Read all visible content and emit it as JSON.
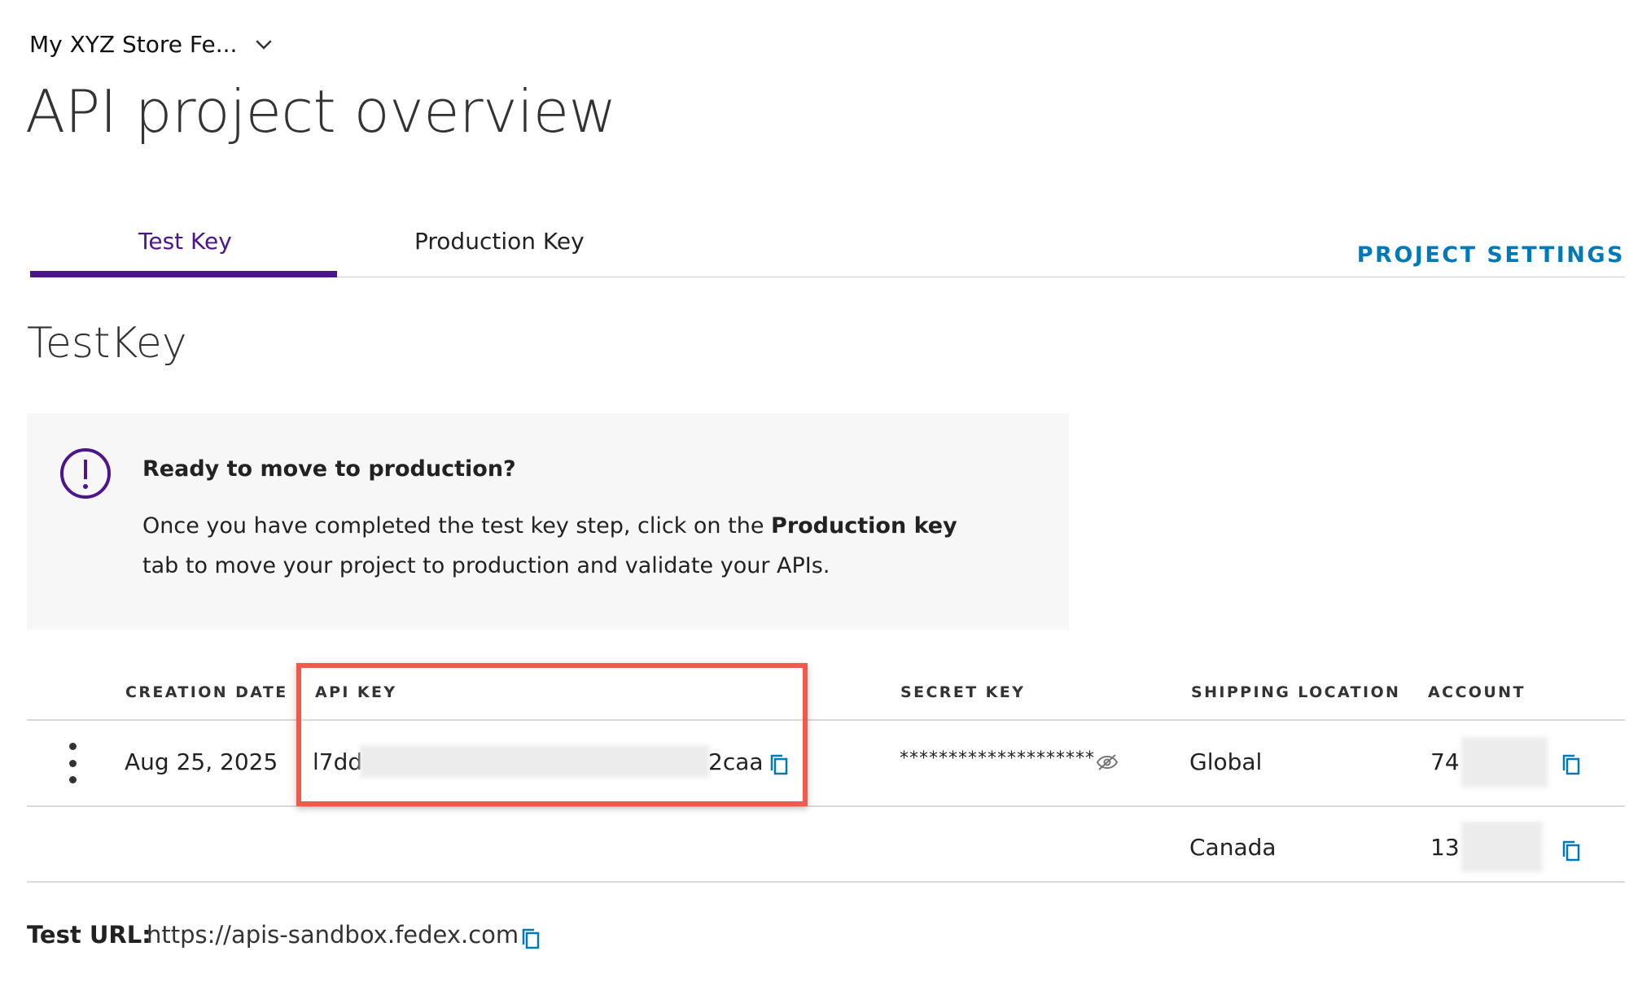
{
  "header": {
    "project_name": "My XYZ Store Fe...",
    "title": "API project overview"
  },
  "tabs": [
    {
      "label": "Test Key",
      "active": true
    },
    {
      "label": "Production Key",
      "active": false
    }
  ],
  "project_settings_label": "PROJECT SETTINGS",
  "section_title": "TestKey",
  "info": {
    "heading": "Ready to move to production?",
    "text_before": "Once you have completed the test key step, click on the ",
    "text_bold": "Production key",
    "text_after": " tab to move your project to production and validate your APIs."
  },
  "table": {
    "headers": {
      "creation_date": "CREATION DATE",
      "api_key": "API KEY",
      "secret_key": "SECRET KEY",
      "shipping_location": "SHIPPING LOCATION",
      "account": "ACCOUNT"
    },
    "rows": [
      {
        "creation_date": "Aug 25, 2025",
        "api_key_start": "l7dd",
        "api_key_end": "2caa",
        "secret_key": "********************",
        "shipping_location": "Global",
        "account_prefix": "740"
      },
      {
        "shipping_location": "Canada",
        "account_prefix": "130"
      }
    ]
  },
  "test_url": {
    "label": "Test URL:",
    "value": "https://apis-sandbox.fedex.com"
  },
  "colors": {
    "brand_purple": "#4D148C",
    "link_blue": "#007AB7",
    "highlight_red": "#F05A4A"
  },
  "icons": [
    "chevron-down-icon",
    "info-icon",
    "copy-icon",
    "eye-off-icon",
    "kebab-menu-icon"
  ]
}
